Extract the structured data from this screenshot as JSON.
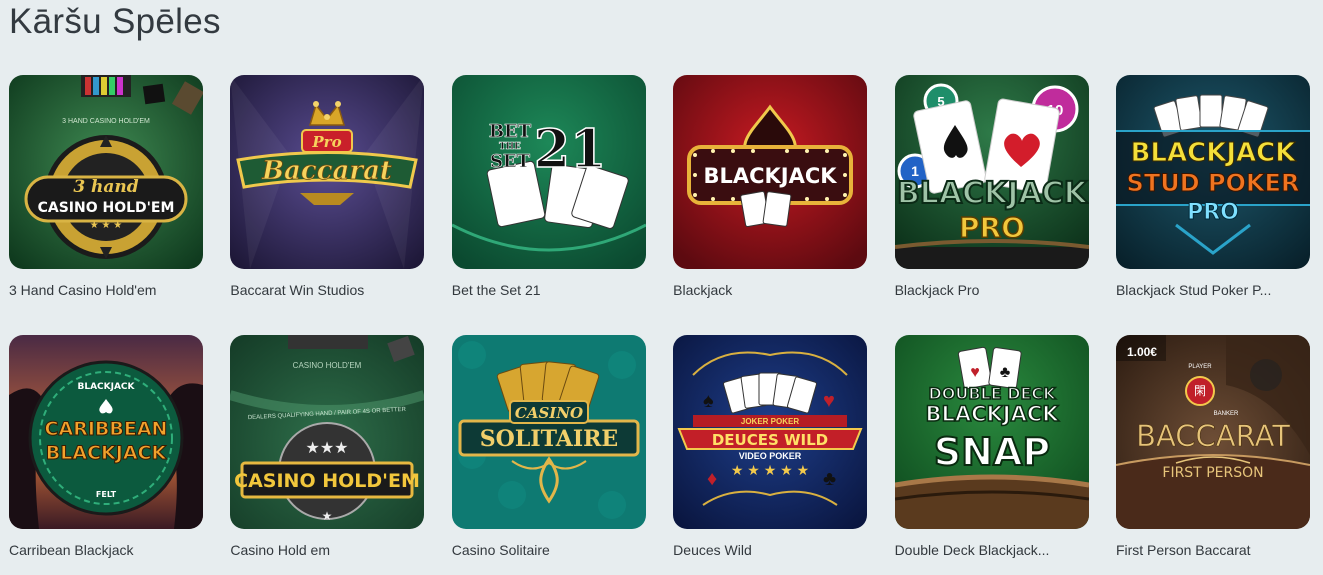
{
  "section": {
    "title": "Kāršu Spēles"
  },
  "games": [
    {
      "label": "3 Hand Casino Hold'em",
      "art": {
        "line1": "3 hand",
        "line2": "CASINO HOLD'EM",
        "header": "3 HAND CASINO HOLD'EM"
      }
    },
    {
      "label": "Baccarat Win Studios",
      "art": {
        "line1": "Pro",
        "line2": "Baccarat"
      }
    },
    {
      "label": "Bet the Set 21",
      "art": {
        "line1": "BET",
        "line2": "THE",
        "line3": "SET",
        "line4": "21"
      }
    },
    {
      "label": "Blackjack",
      "art": {
        "line1": "BLACKJACK"
      }
    },
    {
      "label": "Blackjack Pro",
      "art": {
        "line1": "BLACKJACK",
        "line2": "PRO",
        "chip1": "5",
        "chip2": "10",
        "chip3": "1"
      }
    },
    {
      "label": "Blackjack Stud Poker P...",
      "art": {
        "line1": "BLACKJACK",
        "line2": "STUD POKER",
        "line3": "PRO"
      }
    },
    {
      "label": "Carribean Blackjack",
      "art": {
        "line1": "CARIBBEAN",
        "line2": "BLACKJACK",
        "top": "BLACKJACK",
        "bottom": "FELT"
      }
    },
    {
      "label": "Casino Hold em",
      "art": {
        "line1": "CASINO HOLD'EM",
        "header": "CASINO HOLD'EM",
        "sub": "DEALERS QUALIFYING HAND / PAIR OF 4S OR BETTER"
      }
    },
    {
      "label": "Casino Solitaire",
      "art": {
        "line1": "CASINO",
        "line2": "SOLITAIRE"
      }
    },
    {
      "label": "Deuces Wild",
      "art": {
        "line1": "JOKER POKER",
        "line2": "DEUCES WILD",
        "line3": "VIDEO POKER"
      }
    },
    {
      "label": "Double Deck Blackjack...",
      "art": {
        "line1": "DOUBLE DECK",
        "line2": "BLACKJACK",
        "line3": "SNAP"
      }
    },
    {
      "label": "First Person Baccarat",
      "art": {
        "line1": "BACCARAT",
        "line2": "FIRST PERSON",
        "badge": "1.00€",
        "player": "PLAYER",
        "banker": "BANKER"
      }
    }
  ]
}
